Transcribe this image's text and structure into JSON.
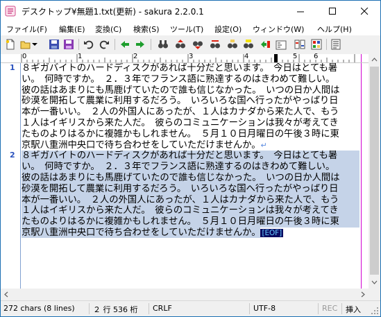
{
  "window": {
    "title": "デスクトップ¥無題1.txt(更新) - sakura 2.2.0.1"
  },
  "menu": [
    "ファイル(F)",
    "編集(E)",
    "変換(C)",
    "検索(S)",
    "ツール(T)",
    "設定(O)",
    "ウィンドウ(W)",
    "ヘルプ(H)"
  ],
  "ruler": [
    "0",
    "1",
    "2",
    "3",
    "4",
    "5",
    "6"
  ],
  "editor": {
    "line_numbers": [
      "1",
      "2"
    ],
    "lines": [
      "８ギガバイトのハードディスクがあれば十分だと思います。　今日はとても暑",
      "い。　何時ですか。　２．３年でフランス語に熟達するのはきわめて難しい。",
      "彼の話はあまりにも馬鹿げていたので誰も信じなかった。　いつの日か人間は",
      "砂漠を開拓して農業に利用するだろう。　いろいろな国へ行ったがやっぱり日",
      "本が一番いい。　２人の外国人にあったが、１人はカナダから来た人で、もう",
      "１人はイギリスから来た人だ。　彼らのコミュニケーションは我々が考えてき",
      "たものよりはるかに複雑かもしれません。　５月１０日月曜日の午後３時に東",
      "京駅八重洲中央口で待ち合わせをしていただけませんか。"
    ],
    "eol_mark": "↵",
    "eof_mark": "[EOF]"
  },
  "status": {
    "chars": "272 chars (8 lines)",
    "position": "２ 行  536 桁",
    "eol": "CRLF",
    "encoding": "UTF-8",
    "rec": "REC",
    "insert": "挿入"
  }
}
